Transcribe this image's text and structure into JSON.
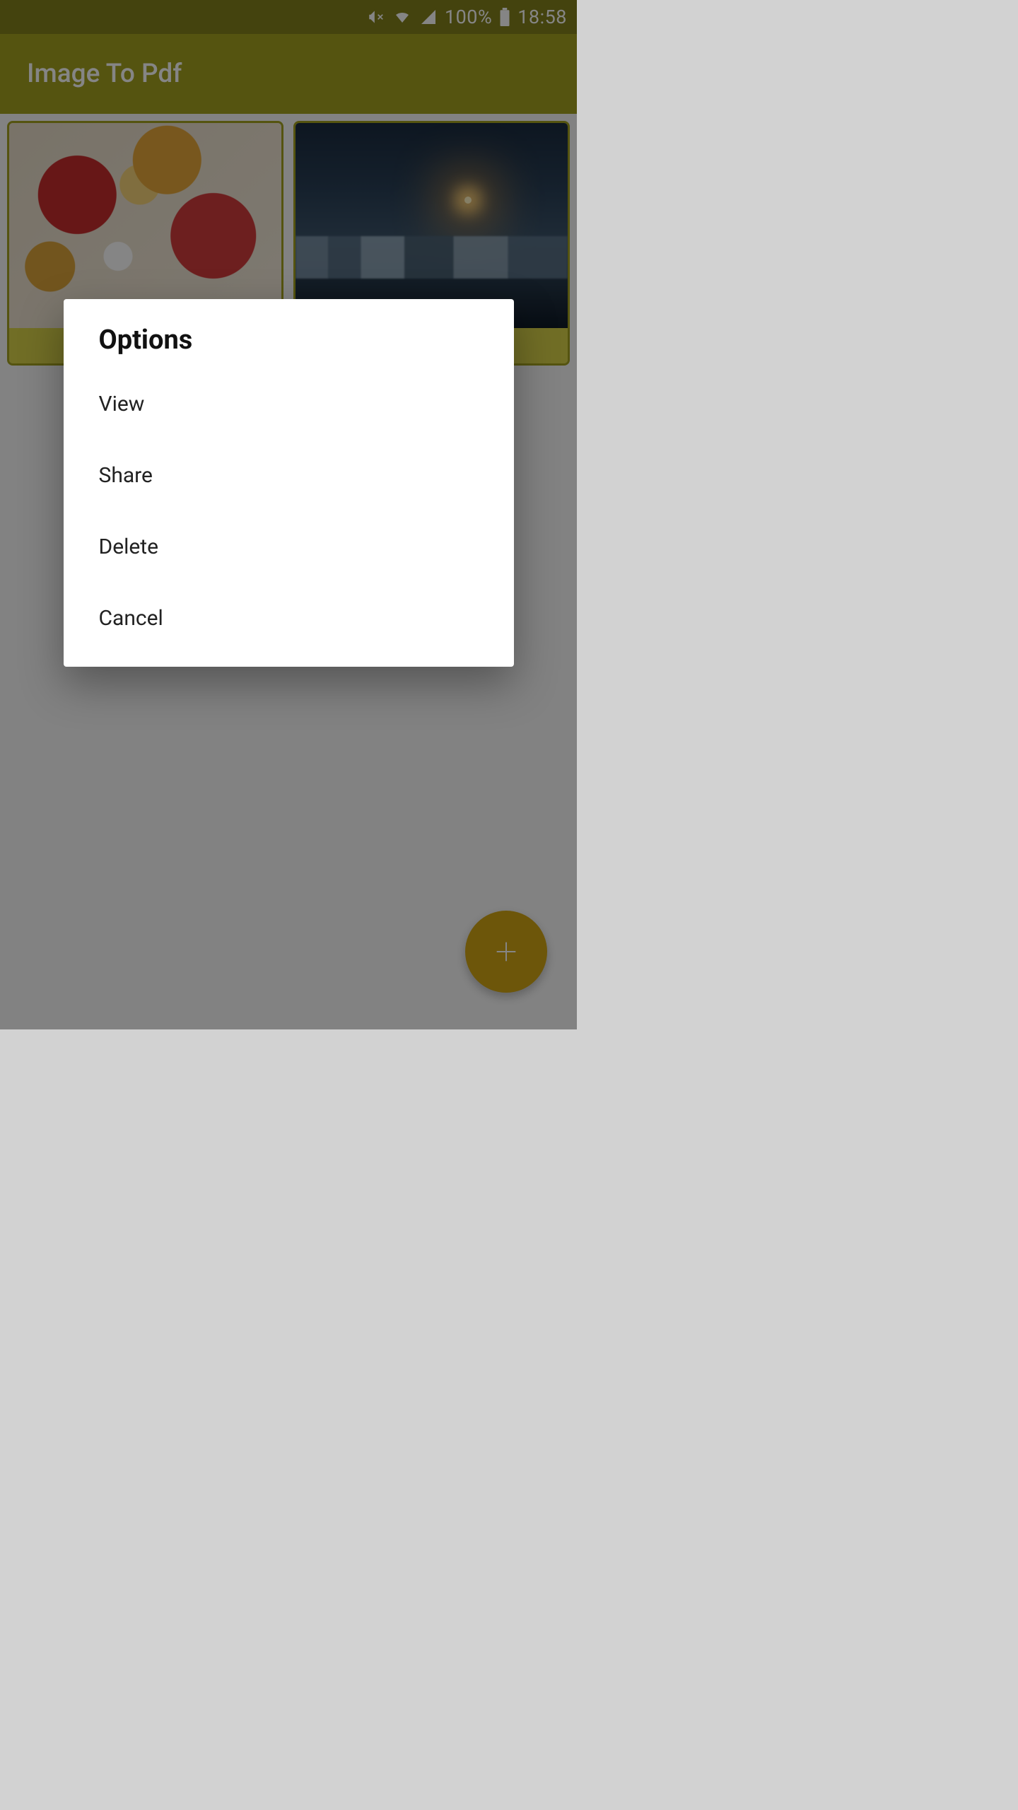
{
  "status": {
    "mute_icon": "mute-vibrate-icon",
    "wifi_icon": "wifi-icon",
    "signal_icon": "cellular-signal-icon",
    "battery_pct": "100%",
    "battery_icon": "battery-full-icon",
    "time": "18:58"
  },
  "app_bar": {
    "title": "Image To Pdf"
  },
  "thumbnails": [
    {
      "name": "image-card-1",
      "alt": "flowers"
    },
    {
      "name": "image-card-2",
      "alt": "sunset-ice"
    }
  ],
  "fab": {
    "name": "add-button",
    "icon": "plus-icon"
  },
  "dialog": {
    "title": "Options",
    "options": [
      {
        "label": "View",
        "name": "option-view"
      },
      {
        "label": "Share",
        "name": "option-share"
      },
      {
        "label": "Delete",
        "name": "option-delete"
      },
      {
        "label": "Cancel",
        "name": "option-cancel"
      }
    ]
  },
  "colors": {
    "accent": "#a4a220",
    "fab": "#d2a514"
  }
}
